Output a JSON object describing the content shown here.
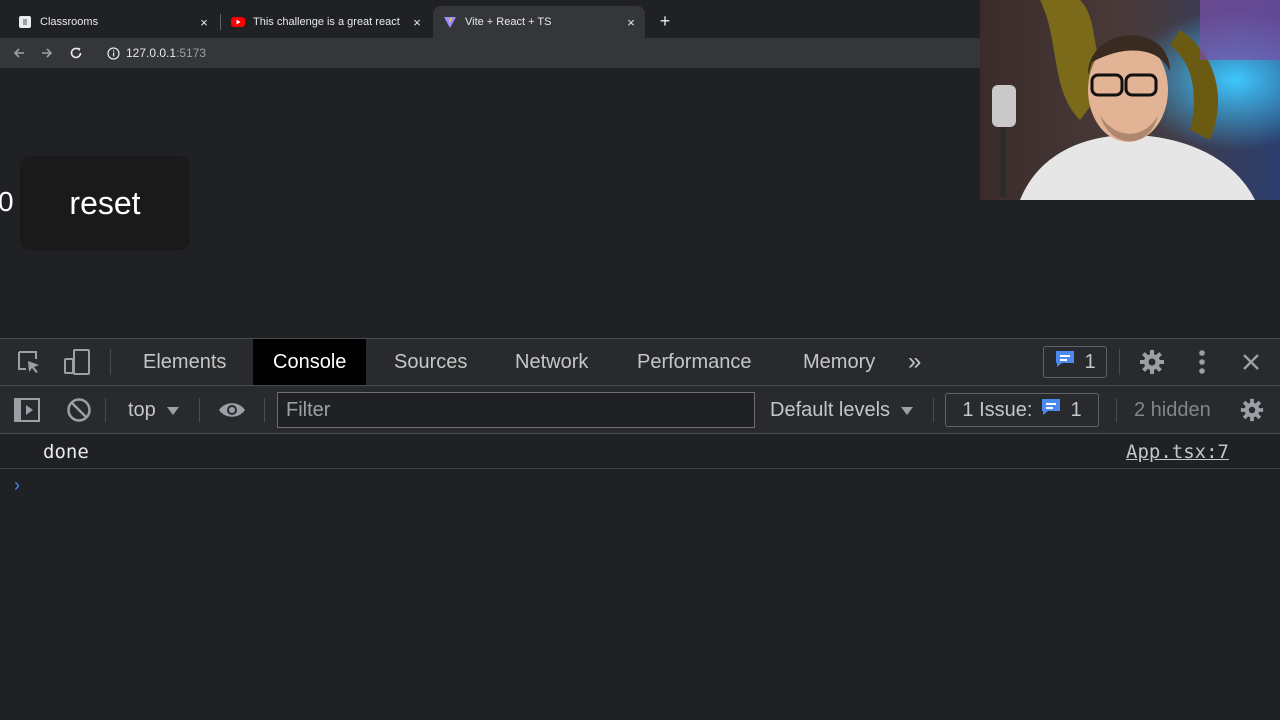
{
  "browser": {
    "tabs": [
      {
        "title": "Classrooms",
        "favicon": "classroom-icon",
        "active": false
      },
      {
        "title": "This challenge is a great react",
        "favicon": "youtube-icon",
        "active": false
      },
      {
        "title": "Vite + React + TS",
        "favicon": "vite-icon",
        "active": true
      }
    ],
    "new_tab_label": "+",
    "close_label": "×",
    "url_host": "127.0.0.1",
    "url_port": ":5173"
  },
  "page": {
    "count": "0",
    "reset_label": "reset"
  },
  "devtools": {
    "tabs": [
      "Elements",
      "Console",
      "Sources",
      "Network",
      "Performance",
      "Memory"
    ],
    "active_tab": "Console",
    "more_tabs_label": "»",
    "issues_count": "1",
    "context": "top",
    "filter_placeholder": "Filter",
    "levels": "Default levels",
    "issue_label": "1 Issue:",
    "issue_count": "1",
    "hidden": "2 hidden",
    "messages": [
      {
        "text": "done",
        "source": "App.tsx:7"
      }
    ],
    "prompt": "›"
  },
  "colors": {
    "accent_blue": "#4d8af0",
    "issue_blue": "#4d8af0",
    "youtube_red": "#ff0000"
  }
}
